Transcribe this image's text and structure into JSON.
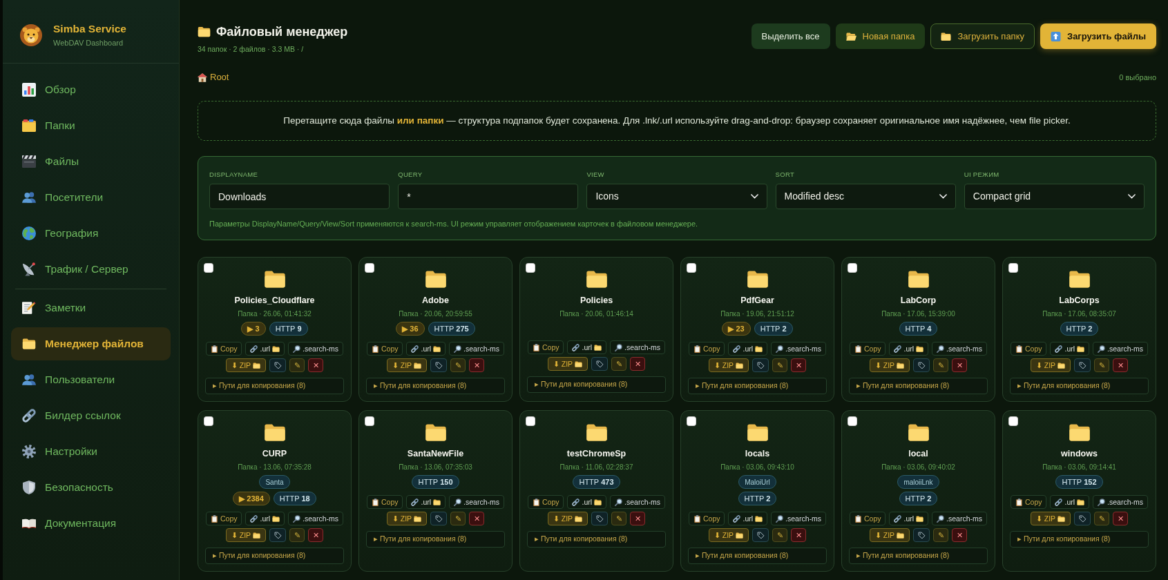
{
  "sidebar": {
    "brand": {
      "title": "Simba Service",
      "subtitle": "WebDAV Dashboard"
    },
    "sections": [
      {
        "items": [
          {
            "kind": "overview",
            "label": "Обзор",
            "selected": false
          },
          {
            "kind": "folders",
            "label": "Папки",
            "selected": false
          },
          {
            "kind": "files",
            "label": "Файлы",
            "selected": false
          },
          {
            "kind": "visitors",
            "label": "Посетители",
            "selected": false
          },
          {
            "kind": "geography",
            "label": "География",
            "selected": false
          },
          {
            "kind": "traffic",
            "label": "Трафик / Сервер",
            "selected": false
          }
        ]
      },
      {
        "items": [
          {
            "kind": "notes",
            "label": "Заметки",
            "selected": false
          },
          {
            "kind": "file_manager",
            "label": "Менеджер файлов",
            "selected": true
          },
          {
            "kind": "users",
            "label": "Пользователи",
            "selected": false
          },
          {
            "kind": "link_builder",
            "label": "Билдер ссылок",
            "selected": false
          },
          {
            "kind": "settings",
            "label": "Настройки",
            "selected": false
          },
          {
            "kind": "security",
            "label": "Безопасность",
            "selected": false
          },
          {
            "kind": "docs",
            "label": "Документация",
            "selected": false
          }
        ]
      }
    ]
  },
  "header": {
    "title": "Файловый менеджер",
    "subtitle": "34 папок · 2 файлов · 3.3 MB · /",
    "buttons": [
      {
        "kind": "select_all",
        "label": "Выделить все"
      },
      {
        "kind": "new_folder",
        "label": "Новая папка"
      },
      {
        "kind": "upload_folder",
        "label": "Загрузить папку"
      },
      {
        "kind": "upload_files",
        "label": "Загрузить файлы"
      }
    ]
  },
  "breadcrumb": [
    {
      "kind": "root",
      "label": "Root"
    }
  ],
  "selection_count": "0 выбрано",
  "drop_zone": {
    "text": "Перетащите сюда файлы **или папки** — структура подпапок будет сохранена. Для .lnk/.url используйте drag-and-drop: браузер сохраняет оригинальное имя надёжнее, чем file picker."
  },
  "filters": {
    "fields": [
      {
        "kind": "text",
        "label": "DISPLAYNAME",
        "value": "Downloads"
      },
      {
        "kind": "text",
        "label": "QUERY",
        "value": "*"
      },
      {
        "kind": "select",
        "label": "VIEW",
        "value": "Icons"
      },
      {
        "kind": "select",
        "label": "SORT",
        "value": "Modified desc"
      },
      {
        "kind": "select",
        "label": "UI РЕЖИМ",
        "value": "Compact grid"
      }
    ],
    "hint": "Параметры DisplayName/Query/View/Sort применяются к search-ms. UI режим управляет отображением карточек в файловом менеджере."
  },
  "cards": [
    {
      "name": "Policies_Cloudflare",
      "meta": "Папка · 26.06, 01:41:32",
      "checked": false,
      "plays": "▶ 3",
      "http": "HTTP **9**",
      "action_rows": [
        [
          {
            "kind": "copy",
            "label": "Copy"
          },
          {
            "kind": "url",
            "label": ".url"
          },
          {
            "kind": "search",
            "label": ".search-ms"
          }
        ],
        [
          {
            "kind": "zip",
            "label": "⬇ ZIP"
          },
          {
            "kind": "tag"
          },
          {
            "kind": "rename",
            "label": "✎"
          },
          {
            "kind": "delete",
            "label": "✕"
          }
        ]
      ],
      "paths": "▸ Пути для копирования (8)"
    },
    {
      "name": "Adobe",
      "meta": "Папка · 20.06, 20:59:55",
      "checked": false,
      "plays": "▶ 36",
      "http": "HTTP **275**",
      "action_rows": [
        [
          {
            "kind": "copy",
            "label": "Copy"
          },
          {
            "kind": "url",
            "label": ".url"
          },
          {
            "kind": "search",
            "label": ".search-ms"
          }
        ],
        [
          {
            "kind": "zip",
            "label": "⬇ ZIP"
          },
          {
            "kind": "tag"
          },
          {
            "kind": "rename",
            "label": "✎"
          },
          {
            "kind": "delete",
            "label": "✕"
          }
        ]
      ],
      "paths": "▸ Пути для копирования (8)"
    },
    {
      "name": "Policies",
      "meta": "Папка · 20.06, 01:46:14",
      "checked": false,
      "action_rows": [
        [
          {
            "kind": "copy",
            "label": "Copy"
          },
          {
            "kind": "url",
            "label": ".url"
          },
          {
            "kind": "search",
            "label": ".search-ms"
          }
        ],
        [
          {
            "kind": "zip",
            "label": "⬇ ZIP"
          },
          {
            "kind": "tag"
          },
          {
            "kind": "rename",
            "label": "✎"
          },
          {
            "kind": "delete",
            "label": "✕"
          }
        ]
      ],
      "paths": "▸ Пути для копирования (8)"
    },
    {
      "name": "PdfGear",
      "meta": "Папка · 19.06, 21:51:12",
      "checked": false,
      "plays": "▶ 23",
      "http": "HTTP **2**",
      "action_rows": [
        [
          {
            "kind": "copy",
            "label": "Copy"
          },
          {
            "kind": "url",
            "label": ".url"
          },
          {
            "kind": "search",
            "label": ".search-ms"
          }
        ],
        [
          {
            "kind": "zip",
            "label": "⬇ ZIP"
          },
          {
            "kind": "tag"
          },
          {
            "kind": "rename",
            "label": "✎"
          },
          {
            "kind": "delete",
            "label": "✕"
          }
        ]
      ],
      "paths": "▸ Пути для копирования (8)"
    },
    {
      "name": "LabCorp",
      "meta": "Папка · 17.06, 15:39:00",
      "checked": false,
      "http": "HTTP **4**",
      "action_rows": [
        [
          {
            "kind": "copy",
            "label": "Copy"
          },
          {
            "kind": "url",
            "label": ".url"
          },
          {
            "kind": "search",
            "label": ".search-ms"
          }
        ],
        [
          {
            "kind": "zip",
            "label": "⬇ ZIP"
          },
          {
            "kind": "tag"
          },
          {
            "kind": "rename",
            "label": "✎"
          },
          {
            "kind": "delete",
            "label": "✕"
          }
        ]
      ],
      "paths": "▸ Пути для копирования (8)"
    },
    {
      "name": "LabCorps",
      "meta": "Папка · 17.06, 08:35:07",
      "checked": false,
      "http": "HTTP **2**",
      "action_rows": [
        [
          {
            "kind": "copy",
            "label": "Copy"
          },
          {
            "kind": "url",
            "label": ".url"
          },
          {
            "kind": "search",
            "label": ".search-ms"
          }
        ],
        [
          {
            "kind": "zip",
            "label": "⬇ ZIP"
          },
          {
            "kind": "tag"
          },
          {
            "kind": "rename",
            "label": "✎"
          },
          {
            "kind": "delete",
            "label": "✕"
          }
        ]
      ],
      "paths": "▸ Пути для копирования (8)"
    },
    {
      "name": "CURP",
      "meta": "Папка · 13.06, 07:35:28",
      "checked": false,
      "tags": [
        "Santa"
      ],
      "plays": "▶ 2384",
      "http": "HTTP **18**",
      "action_rows": [
        [
          {
            "kind": "copy",
            "label": "Copy"
          },
          {
            "kind": "url",
            "label": ".url"
          },
          {
            "kind": "search",
            "label": ".search-ms"
          }
        ],
        [
          {
            "kind": "zip",
            "label": "⬇ ZIP"
          },
          {
            "kind": "tag"
          },
          {
            "kind": "rename",
            "label": "✎"
          },
          {
            "kind": "delete",
            "label": "✕"
          }
        ]
      ],
      "paths": "▸ Пути для копирования (8)"
    },
    {
      "name": "SantaNewFile",
      "meta": "Папка · 13.06, 07:35:03",
      "checked": false,
      "http": "HTTP **150**",
      "action_rows": [
        [
          {
            "kind": "copy",
            "label": "Copy"
          },
          {
            "kind": "url",
            "label": ".url"
          },
          {
            "kind": "search",
            "label": ".search-ms"
          }
        ],
        [
          {
            "kind": "zip",
            "label": "⬇ ZIP"
          },
          {
            "kind": "tag"
          },
          {
            "kind": "rename",
            "label": "✎"
          },
          {
            "kind": "delete",
            "label": "✕"
          }
        ]
      ],
      "paths": "▸ Пути для копирования (8)"
    },
    {
      "name": "testChromeSp",
      "meta": "Папка · 11.06, 02:28:37",
      "checked": false,
      "http": "HTTP **473**",
      "action_rows": [
        [
          {
            "kind": "copy",
            "label": "Copy"
          },
          {
            "kind": "url",
            "label": ".url"
          },
          {
            "kind": "search",
            "label": ".search-ms"
          }
        ],
        [
          {
            "kind": "zip",
            "label": "⬇ ZIP"
          },
          {
            "kind": "tag"
          },
          {
            "kind": "rename",
            "label": "✎"
          },
          {
            "kind": "delete",
            "label": "✕"
          }
        ]
      ],
      "paths": "▸ Пути для копирования (8)"
    },
    {
      "name": "locals",
      "meta": "Папка · 03.06, 09:43:10",
      "checked": false,
      "tags": [
        "MaloiUrl"
      ],
      "http": "HTTP **2**",
      "action_rows": [
        [
          {
            "kind": "copy",
            "label": "Copy"
          },
          {
            "kind": "url",
            "label": ".url"
          },
          {
            "kind": "search",
            "label": ".search-ms"
          }
        ],
        [
          {
            "kind": "zip",
            "label": "⬇ ZIP"
          },
          {
            "kind": "tag"
          },
          {
            "kind": "rename",
            "label": "✎"
          },
          {
            "kind": "delete",
            "label": "✕"
          }
        ]
      ],
      "paths": "▸ Пути для копирования (8)"
    },
    {
      "name": "local",
      "meta": "Папка · 03.06, 09:40:02",
      "checked": false,
      "tags": [
        "maloiiLnk"
      ],
      "http": "HTTP **2**",
      "action_rows": [
        [
          {
            "kind": "copy",
            "label": "Copy"
          },
          {
            "kind": "url",
            "label": ".url"
          },
          {
            "kind": "search",
            "label": ".search-ms"
          }
        ],
        [
          {
            "kind": "zip",
            "label": "⬇ ZIP"
          },
          {
            "kind": "tag"
          },
          {
            "kind": "rename",
            "label": "✎"
          },
          {
            "kind": "delete",
            "label": "✕"
          }
        ]
      ],
      "paths": "▸ Пути для копирования (8)"
    },
    {
      "name": "windows",
      "meta": "Папка · 03.06, 09:14:41",
      "checked": false,
      "http": "HTTP **152**",
      "action_rows": [
        [
          {
            "kind": "copy",
            "label": "Copy"
          },
          {
            "kind": "url",
            "label": ".url"
          },
          {
            "kind": "search",
            "label": ".search-ms"
          }
        ],
        [
          {
            "kind": "zip",
            "label": "⬇ ZIP"
          },
          {
            "kind": "tag"
          },
          {
            "kind": "rename",
            "label": "✎"
          },
          {
            "kind": "delete",
            "label": "✕"
          }
        ]
      ],
      "paths": "▸ Пути для копирования (8)"
    }
  ]
}
